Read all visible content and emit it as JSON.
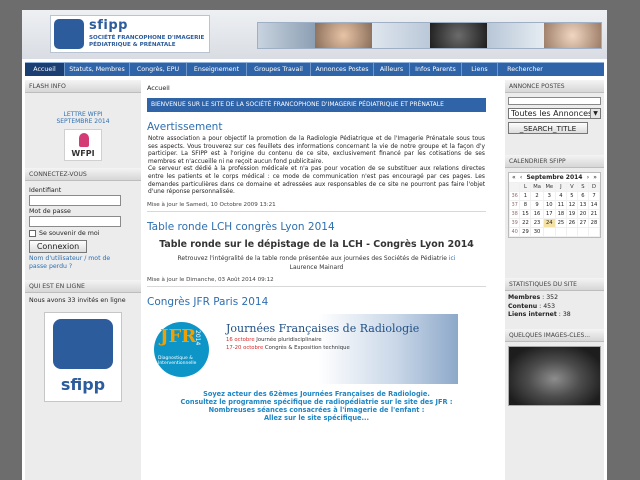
{
  "header": {
    "logo_brand": "sfipp",
    "logo_line1": "SOCIÉTÉ FRANCOPHONE D'IMAGERIE",
    "logo_line2": "PÉDIATRIQUE & PRÉNATALE"
  },
  "nav": [
    {
      "label": "Accueil",
      "active": true
    },
    {
      "label": "Statuts, Membres"
    },
    {
      "label": "Congrès, EPU"
    },
    {
      "label": "Enseignement"
    },
    {
      "label": "Groupes Travail"
    },
    {
      "label": "Annonces Postes"
    },
    {
      "label": "Ailleurs"
    },
    {
      "label": "Infos Parents"
    },
    {
      "label": "Liens"
    },
    {
      "label": "Rechercher"
    }
  ],
  "left": {
    "flash_title": "FLASH INFO",
    "flash_link_line1": "LETTRE WFPI",
    "flash_link_line2": "SEPTEMBRE 2014",
    "wfpi_label": "WFPI",
    "login_title": "CONNECTEZ-VOUS",
    "identifiant_label": "Identifiant",
    "password_label": "Mot de passe",
    "remember_label": "Se souvenir de moi",
    "login_button": "Connexion",
    "forgot_link_line1": "Nom d'utilisateur / mot de",
    "forgot_link_line2": "passe perdu ?",
    "online_title": "QUI EST EN LIGNE",
    "online_text": "Nous avons 33 invités en ligne",
    "big_logo_label": "sfipp"
  },
  "center": {
    "breadcrumb": "Accueil",
    "welcome": "BIENVENUE SUR LE SITE DE LA SOCIÉTÉ FRANCOPHONE D'IMAGERIE PÉDIATRIQUE ET PRÉNATALE",
    "article1": {
      "title": "Avertissement",
      "body": "Notre association a pour objectif la promotion de la Radiologie Pédiatrique et de l'Imagerie Prénatale sous tous ses aspects. Vous trouverez sur ces feuillets des informations concernant la vie de notre groupe et la façon d'y participer. La SFIPP est à l'origine du contenu de ce site, exclusivement financé par les cotisations de ses membres et n'accueille ni ne reçoit aucun fond publicitaire.",
      "body2": "Ce serveur est dédié à la profession médicale et n'a pas pour vocation de se substituer aux relations directes entre les patients et le corps médical : ce mode de communication n'est pas encouragé par ces pages. Les demandes particulières dans ce domaine et adressées aux responsables de ce site ne pourront pas faire l'objet d'une réponse personnalisée.",
      "date": "Mise à jour le Samedi, 10 Octobre 2009 13:21"
    },
    "article2": {
      "title": "Table ronde LCH congrès Lyon 2014",
      "heading": "Table ronde sur le dépistage de la LCH - Congrès Lyon 2014",
      "line1": "Retrouvez l'intégralité de la table ronde présentée aux journées des Sociétés de Pédiatrie",
      "link": "ici",
      "line2": "Laurence Mainard",
      "date": "Mise à jour le Dimanche, 03 Août 2014 09:12"
    },
    "article3": {
      "title": "Congrès JFR Paris 2014",
      "jfr_logo": "JFR",
      "jfr_year": "2014",
      "jfr_sub1": "Diagnostique &",
      "jfr_sub2": "Interventionnelle",
      "jfr_heading": "Journées Françaises de Radiologie",
      "jfr_line1_date": "16 octobre",
      "jfr_line1_text": " Journée pluridisciplinaire",
      "jfr_line2_date": "17-20 octobre",
      "jfr_line2_text": " Congrès & Exposition technique",
      "blue1": "Soyez acteur des 62èmes Journées Françaises de Radiologie.",
      "blue2": "Consultez le programme spécifique de radiopédiatrie sur le site des JFR :",
      "blue3": "Nombreuses séances consacrées à l'imagerie de l'enfant :",
      "blue4": "Allez sur le site spécifique..."
    }
  },
  "right": {
    "annonce_title": "ANNONCE POSTES",
    "annonce_select_value": "Toutes les Annonces",
    "search_button": "_SEARCH_TITLE",
    "calendar_title": "CALENDRIER SFIPP",
    "calendar": {
      "prev": "«",
      "prev2": "‹",
      "month": "Septembre 2014",
      "next": "›",
      "next2": "»",
      "days": [
        "L",
        "Ma",
        "Me",
        "J",
        "V",
        "S",
        "D"
      ],
      "weeks": [
        {
          "wk": "36",
          "d": [
            "1",
            "2",
            "3",
            "4",
            "5",
            "6",
            "7"
          ]
        },
        {
          "wk": "37",
          "d": [
            "8",
            "9",
            "10",
            "11",
            "12",
            "13",
            "14"
          ]
        },
        {
          "wk": "38",
          "d": [
            "15",
            "16",
            "17",
            "18",
            "19",
            "20",
            "21"
          ]
        },
        {
          "wk": "39",
          "d": [
            "22",
            "23",
            "24",
            "25",
            "26",
            "27",
            "28"
          ]
        },
        {
          "wk": "40",
          "d": [
            "29",
            "30",
            "",
            "",
            "",
            "",
            ""
          ]
        }
      ],
      "today": "24"
    },
    "stats_title": "STATISTIQUES DU SITE",
    "stats": [
      {
        "label": "Membres",
        "value": "352"
      },
      {
        "label": "Contenu",
        "value": "453"
      },
      {
        "label": "Liens internet",
        "value": "38"
      }
    ],
    "images_title": "QUELQUES IMAGES-CLES..."
  }
}
